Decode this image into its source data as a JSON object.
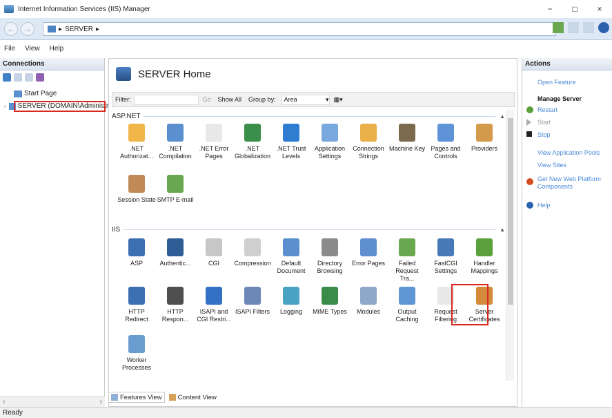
{
  "window": {
    "title": "Internet Information Services (IIS) Manager",
    "minimize": "−",
    "maximize": "□",
    "close": "×"
  },
  "address": {
    "back": "←",
    "forward": "→",
    "sep1": "▸",
    "crumb": "SERVER",
    "sep2": "▸"
  },
  "menu": [
    "File",
    "View",
    "Help"
  ],
  "connections": {
    "header": "Connections",
    "start_page": "Start Page",
    "server_node": "SERVER (DOMAIN\\Administrator)",
    "scroll_left": "‹",
    "scroll_right": "›"
  },
  "main": {
    "title": "SERVER Home",
    "filter_label": "Filter:",
    "go_label": "Go",
    "show_all": "Show All",
    "group_by": "Group by:",
    "group_value": "Area",
    "aspnet_group": "ASP.NET",
    "iis_group": "IIS",
    "aspnet_features": [
      ".NET\nAuthorizat...",
      ".NET\nCompilation",
      ".NET Error\nPages",
      ".NET\nGlobalization",
      ".NET Trust\nLevels",
      "Application\nSettings",
      "Connection\nStrings",
      "Machine Key",
      "Pages and\nControls",
      "Providers",
      "Session State",
      "SMTP E-mail"
    ],
    "iis_features": [
      "ASP",
      "Authentic...",
      "CGI",
      "Compression",
      "Default\nDocument",
      "Directory\nBrowsing",
      "Error Pages",
      "Failed\nRequest Tra...",
      "FastCGI\nSettings",
      "Handler\nMappings",
      "HTTP\nRedirect",
      "HTTP\nRespon...",
      "ISAPI and\nCGI Restri...",
      "ISAPI Filters",
      "Logging",
      "MIME Types",
      "Modules",
      "Output\nCaching",
      "Request\nFiltering",
      "Server\nCertificates",
      "Worker\nProcesses"
    ],
    "features_view": "Features View",
    "content_view": "Content View"
  },
  "actions": {
    "header": "Actions",
    "open_feature": "Open Feature",
    "manage_server": "Manage Server",
    "restart": "Restart",
    "start": "Start",
    "stop": "Stop",
    "view_app_pools": "View Application Pools",
    "view_sites": "View Sites",
    "get_new": "Get New Web Platform\nComponents",
    "help": "Help"
  },
  "status": "Ready",
  "colors": {
    "highlight": "#d8281f",
    "link": "#4a8ad6",
    "header_bg": "#dfe9f5"
  }
}
